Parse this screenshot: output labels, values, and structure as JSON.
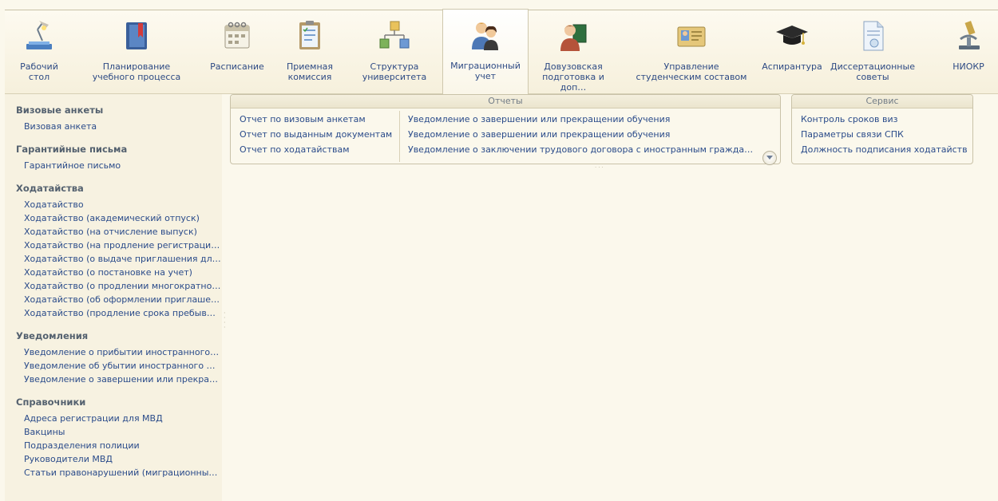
{
  "sections": [
    {
      "label": "Рабочий\nстол",
      "icon": "desktop-lamp-icon"
    },
    {
      "label": "Планирование\nучебного процесса",
      "icon": "planning-book-icon"
    },
    {
      "label": "Расписание",
      "icon": "calendar-icon"
    },
    {
      "label": "Приемная\nкомиссия",
      "icon": "clipboard-icon"
    },
    {
      "label": "Структура\nуниверситета",
      "icon": "structure-icon"
    },
    {
      "label": "Миграционный\nучет",
      "icon": "people-icon"
    },
    {
      "label": "Довузовская\nподготовка и доп…",
      "icon": "student-icon"
    },
    {
      "label": "Управление\nстуденческим составом",
      "icon": "id-card-icon"
    },
    {
      "label": "Аспирантура",
      "icon": "graduation-cap-icon"
    },
    {
      "label": "Диссертационные\nсоветы",
      "icon": "document-icon"
    },
    {
      "label": "НИОКР",
      "icon": "microscope-icon"
    }
  ],
  "nav": {
    "groups": [
      {
        "title": "Визовые анкеты",
        "items": [
          "Визовая анкета"
        ]
      },
      {
        "title": "Гарантийные письма",
        "items": [
          "Гарантийное письмо"
        ]
      },
      {
        "title": "Ходатайства",
        "items": [
          "Ходатайство",
          "Ходатайство (академический отпуск)",
          "Ходатайство (на отчисление выпуск)",
          "Ходатайство (на продление регистраци…",
          "Ходатайство (о выдаче приглашения дл…",
          "Ходатайство (о постановке на учет)",
          "Ходатайство (о продлении многократно…",
          "Ходатайство (об оформлении приглаше…",
          "Ходатайство (продление срока пребыв…"
        ]
      },
      {
        "title": "Уведомления",
        "items": [
          "Уведомление о прибытии иностранного…",
          "Уведомление об убытии иностранного …",
          "Уведомление о завершении или прекра…"
        ]
      },
      {
        "title": "Справочники",
        "items": [
          "Адреса регистрации для МВД",
          "Вакцины",
          "Подразделения полиции",
          "Руководители МВД",
          "Статьи правонарушений (миграционны…"
        ]
      }
    ]
  },
  "reports": {
    "title": "Отчеты",
    "col1": [
      "Отчет по визовым анкетам",
      "Отчет по выданным документам",
      "Отчет по ходатайствам"
    ],
    "col2": [
      "Уведомление о завершении или прекращении обучения",
      "Уведомление о завершении или прекращении обучения",
      "Уведомление о заключении трудового договора с иностранным граждан…"
    ]
  },
  "service": {
    "title": "Сервис",
    "items": [
      "Контроль сроков виз",
      "Параметры связи СПК",
      "Должность подписания ходатайств"
    ]
  },
  "colors": {
    "link": "#2a4b8a",
    "background": "#fbf8ec",
    "nav_bg": "#f7f2e1"
  }
}
